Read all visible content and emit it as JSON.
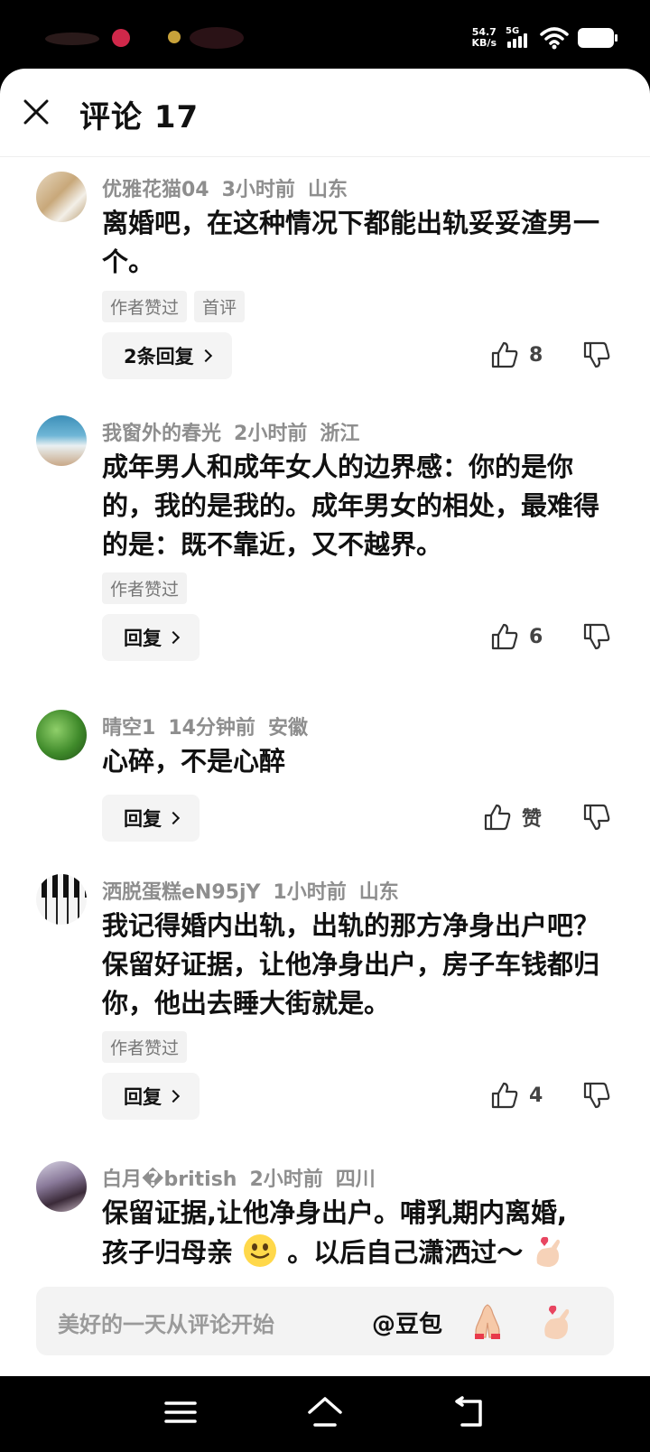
{
  "status_bar": {
    "net_speed_value": "54.7",
    "net_speed_unit": "KB/s",
    "network": "5G"
  },
  "header": {
    "title": "评论 17"
  },
  "comments": [
    {
      "user": "优雅花猫04",
      "time": "3小时前",
      "location": "山东",
      "text": "离婚吧，在这种情况下都能出轨妥妥渣男一个。",
      "tags": [
        "作者赞过",
        "首评"
      ],
      "reply_label": "2条回复",
      "likes": "8"
    },
    {
      "user": "我窗外的春光",
      "time": "2小时前",
      "location": "浙江",
      "text": "成年男人和成年女人的边界感：你的是你的，我的是我的。成年男女的相处，最难得的是：既不靠近，又不越界。",
      "tags": [
        "作者赞过"
      ],
      "reply_label": "回复",
      "likes": "6"
    },
    {
      "user": "晴空1",
      "time": "14分钟前",
      "location": "安徽",
      "text": "心碎，不是心醉",
      "tags": [],
      "reply_label": "回复",
      "likes": "赞"
    },
    {
      "user": "洒脱蛋糕eN95jY",
      "time": "1小时前",
      "location": "山东",
      "text": "我记得婚内出轨，出轨的那方净身出户吧？保留好证据，让他净身出户，房子车钱都归你，他出去睡大街就是。",
      "tags": [
        "作者赞过"
      ],
      "reply_label": "回复",
      "likes": "4"
    },
    {
      "user": "白月�british",
      "time": "2小时前",
      "location": "四川",
      "text_line1": "保留证据,让他净身出户。哺乳期内离婚,",
      "text_line2_a": "孩子归母亲",
      "text_line2_b": "。以后自己潇洒过～"
    }
  ],
  "input_bar": {
    "placeholder": "美好的一天从评论开始",
    "mention": "@豆包"
  },
  "icons": [
    "close-icon",
    "thumbs-up-icon",
    "thumbs-down-icon",
    "smile-emoji-icon",
    "heart-hands-emoji-icon",
    "pray-hands-emoji-icon",
    "menu-icon",
    "home-icon",
    "back-icon"
  ],
  "colors": {
    "meta_gray": "#8e8e8e",
    "tag_bg": "#f2f2f2",
    "reply_bg": "#f4f4f4",
    "input_bg": "#f3f3f3"
  }
}
